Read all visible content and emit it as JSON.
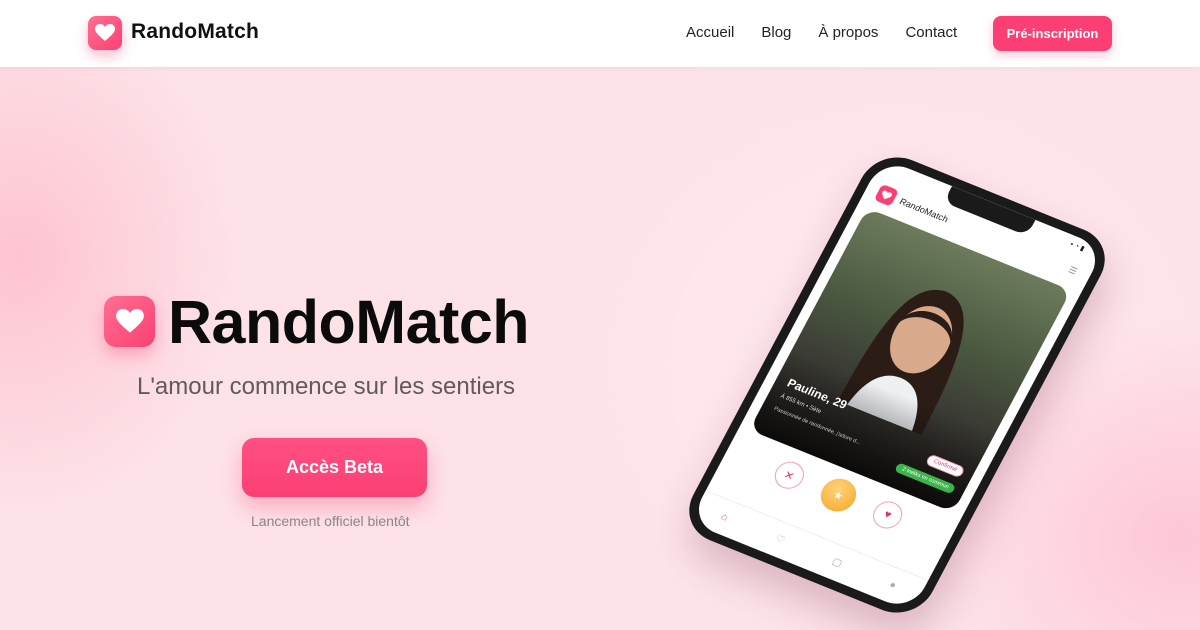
{
  "nav": {
    "brand": "RandoMatch",
    "links": [
      {
        "label": "Accueil"
      },
      {
        "label": "Blog"
      },
      {
        "label": "À propos"
      },
      {
        "label": "Contact"
      }
    ],
    "cta_label": "Pré-inscription"
  },
  "hero": {
    "title": "RandoMatch",
    "tagline": "L'amour commence sur les sentiers",
    "cta_label": "Accès Beta",
    "note": "Lancement officiel bientôt"
  },
  "phone": {
    "app_name": "RandoMatch",
    "profile": {
      "name": "Pauline, 29",
      "meta": "À 855 km • Sète",
      "bio": "Passionnée de randonnée, j'adore d...",
      "badge": "Confirmé",
      "tag": "2 trekks en commun"
    },
    "actions": {
      "reject_icon": "✕",
      "super_icon": "★",
      "like_icon": "♥"
    },
    "tabs": [
      {
        "icon": "home-icon",
        "glyph": "⌂"
      },
      {
        "icon": "matches-icon",
        "glyph": "♡"
      },
      {
        "icon": "chat-icon",
        "glyph": "▢"
      },
      {
        "icon": "profile-icon",
        "glyph": "●"
      }
    ]
  },
  "colors": {
    "brand": "#fb3f74",
    "hero_bg": "#fde3e8",
    "text_dark": "#0b0b0b",
    "text_muted": "#5f5a5c",
    "star_gold": "#f5a623",
    "tag_green": "#3bb54a"
  }
}
